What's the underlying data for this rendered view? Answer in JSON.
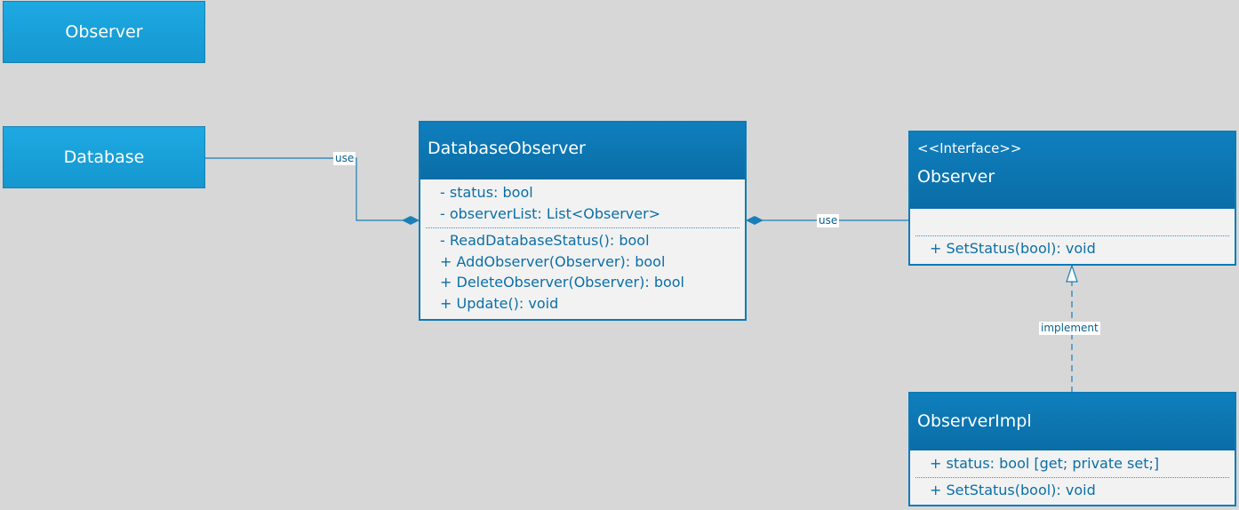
{
  "boxes": {
    "observer_box": "Observer",
    "database_box": "Database"
  },
  "database_observer": {
    "title": "DatabaseObserver",
    "attributes": [
      "- status: bool",
      "- observerList: List<Observer>"
    ],
    "operations": [
      "- ReadDatabaseStatus(): bool",
      "+ AddObserver(Observer): bool",
      "+ DeleteObserver(Observer): bool",
      "+ Update(): void"
    ]
  },
  "observer_interface": {
    "stereotype": "<<Interface>>",
    "title": "Observer",
    "operations": [
      "+ SetStatus(bool): void"
    ]
  },
  "observer_impl": {
    "title": "ObserverImpl",
    "attributes": [
      "+ status: bool [get; private set;]"
    ],
    "operations": [
      "+ SetStatus(bool): void"
    ]
  },
  "connectors": {
    "db_to_dbobserver": "use",
    "dbobserver_to_observer": "use",
    "impl_to_observer": "implement"
  },
  "colors": {
    "background": "#d7d7d7",
    "header": "#0b75b0",
    "simple_box": "#1ba3dc",
    "line": "#1a7fb8"
  }
}
